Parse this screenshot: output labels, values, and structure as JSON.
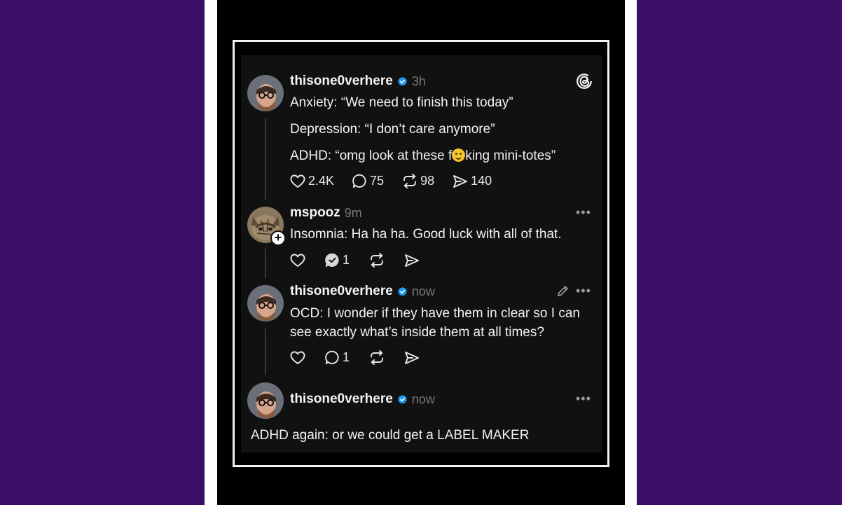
{
  "colors": {
    "page_background": "#3c0f66",
    "card_background": "#111111",
    "verified": "#1d9bf0"
  },
  "posts": [
    {
      "username": "thisone0verhere",
      "verified": true,
      "time": "3h",
      "lines": [
        "Anxiety: “We need to finish this today”",
        "Depression: “I don’t care anymore”"
      ],
      "line3_before": "ADHD: “omg look at these f",
      "line3_emoji": "smiling-face-emoji",
      "line3_after": "king mini-totes”",
      "likes": "2.4K",
      "replies": "75",
      "reposts": "98",
      "shares": "140"
    },
    {
      "username": "mspooz",
      "time": "9m",
      "text": "Insomnia: Ha ha ha. Good luck with all of that.",
      "replies": "1"
    },
    {
      "username": "thisone0verhere",
      "verified": true,
      "time": "now",
      "lines": [
        "OCD: I wonder if they have them in clear so I can",
        "see exactly what’s inside them at all times?"
      ],
      "replies": "1"
    },
    {
      "username": "thisone0verhere",
      "verified": true,
      "time": "now",
      "text": "ADHD again: or we could get a LABEL MAKER"
    }
  ],
  "icons": {
    "app_logo": "threads-logo-icon",
    "more": "more-icon",
    "edit": "pencil-icon"
  }
}
